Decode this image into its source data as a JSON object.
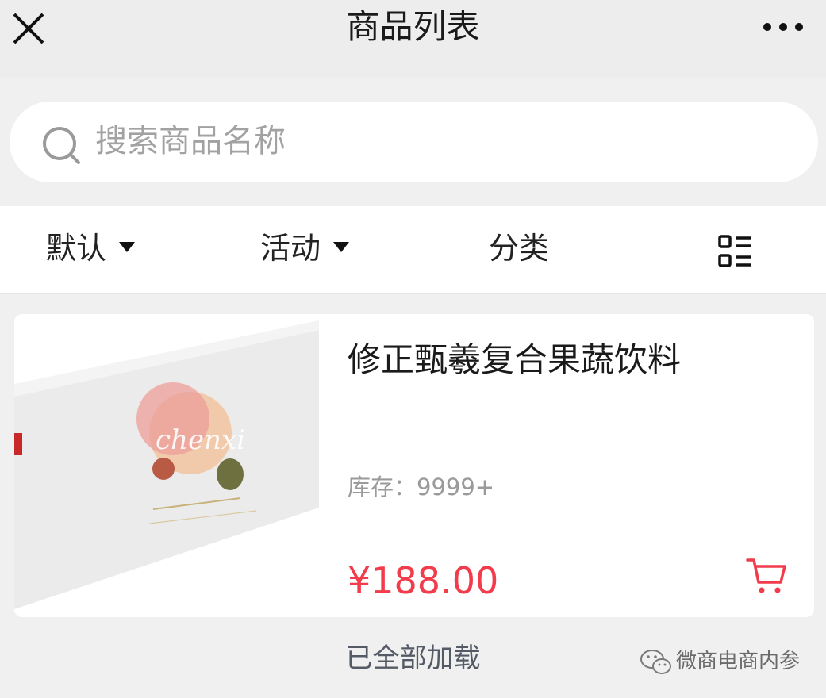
{
  "header": {
    "title": "商品列表",
    "close_icon": "close-icon",
    "more_icon": "more-icon"
  },
  "search": {
    "placeholder": "搜索商品名称",
    "icon": "search-icon"
  },
  "filters": {
    "items": [
      {
        "label": "默认",
        "icon": "triangle-down-icon"
      },
      {
        "label": "活动",
        "icon": "triangle-down-icon"
      },
      {
        "label": "分类"
      }
    ],
    "view_toggle_icon": "list-view-icon"
  },
  "products": [
    {
      "name": "修正甄羲复合果蔬饮料",
      "stock": "库存：9999+",
      "price": "¥188.00",
      "cart_icon": "cart-icon",
      "image_text": "chenxi"
    }
  ],
  "footer": {
    "status": "已全部加载"
  },
  "watermark": {
    "text": "微商电商内参",
    "icon": "wechat-icon"
  },
  "colors": {
    "price": "#f23b4b",
    "background": "#f0f0f0",
    "card": "#ffffff"
  }
}
